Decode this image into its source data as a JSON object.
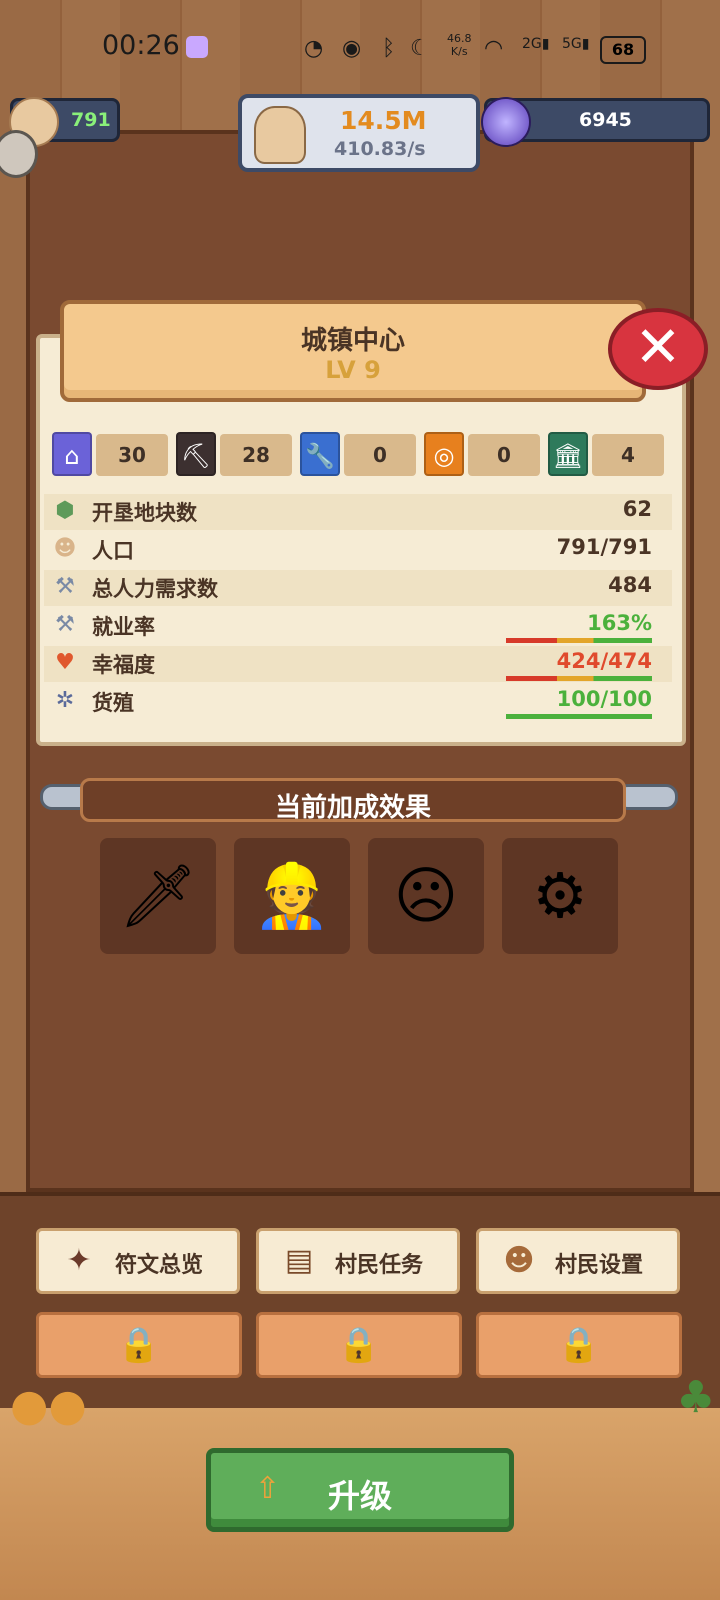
{
  "status_bar": {
    "time": "00:26",
    "net_speed_value": "46.8",
    "net_speed_unit": "K/s",
    "battery": "68"
  },
  "resources": {
    "population": "791",
    "gold": "14.5M",
    "gold_rate": "410.83/s",
    "gems": "6945"
  },
  "building": {
    "title": "城镇中心",
    "level": "LV 9"
  },
  "chips": [
    {
      "icon": "house-icon",
      "value": "30",
      "color": "#6b62d8"
    },
    {
      "icon": "pickaxe-icon",
      "value": "28",
      "color": "#3c3030"
    },
    {
      "icon": "wrench-icon",
      "value": "0",
      "color": "#3a6fd0"
    },
    {
      "icon": "pot-icon",
      "value": "0",
      "color": "#e7801e"
    },
    {
      "icon": "temple-icon",
      "value": "4",
      "color": "#2e7a5b"
    }
  ],
  "stats": [
    {
      "label": "开垦地块数",
      "value": "62"
    },
    {
      "label": "人口",
      "value": "791/791"
    },
    {
      "label": "总人力需求数",
      "value": "484"
    },
    {
      "label": "就业率",
      "value": "163%"
    },
    {
      "label": "幸福度",
      "value": "424/474"
    },
    {
      "label": "货殖",
      "value": "100/100"
    }
  ],
  "bonus": {
    "title": "当前加成效果",
    "items": [
      "sword-buff-icon",
      "workers-buff-icon",
      "unhappy-face-icon",
      "gear-buff-icon"
    ]
  },
  "buttons": {
    "runes": "符文总览",
    "tasks": "村民任务",
    "settings": "村民设置",
    "upgrade": "升级"
  },
  "colors": {
    "stat_green": "#4bb13c",
    "stat_red": "#e04a2d",
    "upgrade_green": "#5fae5a"
  }
}
